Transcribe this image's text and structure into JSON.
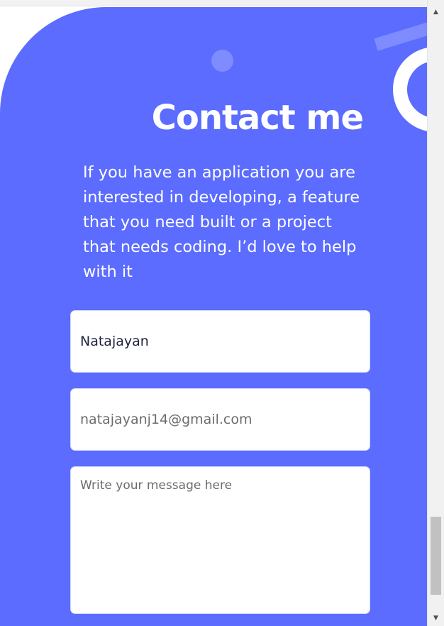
{
  "contact": {
    "title": "Contact me",
    "description": "If you have an application you are interested in developing, a feature that you need built or a project that needs coding. I’d love to help with it"
  },
  "form": {
    "name_value": "Natajayan",
    "email_placeholder": "natajayanj14@gmail.com",
    "message_placeholder": "Write your message here"
  },
  "icons": {
    "scroll_up": "scroll-up-arrow-icon",
    "scroll_down": "scroll-down-arrow-icon"
  },
  "colors": {
    "accent": "#5b6cff",
    "accent_light": "#7f8cff",
    "field_bg": "#ffffff"
  }
}
